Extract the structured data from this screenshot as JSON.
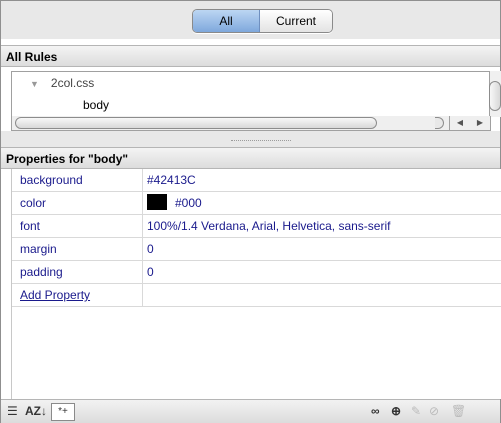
{
  "segmented": {
    "all_label": "All",
    "current_label": "Current",
    "selected": "All"
  },
  "rules_panel": {
    "header": "All Rules",
    "tree": [
      {
        "label": "2col.css",
        "expanded": true
      },
      {
        "label": "body"
      }
    ]
  },
  "properties_panel": {
    "header": "Properties for \"body\"",
    "rows": [
      {
        "name": "background",
        "value": "#42413C"
      },
      {
        "name": "color",
        "value": "#000",
        "swatch": "#000000"
      },
      {
        "name": "font",
        "value": "100%/1.4 Verdana, Arial, Helvetica, sans-serif"
      },
      {
        "name": "margin",
        "value": "0"
      },
      {
        "name": "padding",
        "value": "0"
      }
    ],
    "add_property": "Add Property"
  },
  "toolbar": {
    "left_icons": [
      "show-category-view-icon",
      "show-alphabetical-view-icon",
      "show-set-properties-only-icon"
    ],
    "right_icons": [
      "attach-style-sheet-icon",
      "new-css-rule-icon",
      "edit-rule-icon",
      "disable-property-icon",
      "delete-rule-icon"
    ],
    "az_text": "AZ",
    "star_text": "*+"
  },
  "colors": {
    "accent": "#1a1a8c",
    "selected_segment": "#7fa8dc"
  }
}
